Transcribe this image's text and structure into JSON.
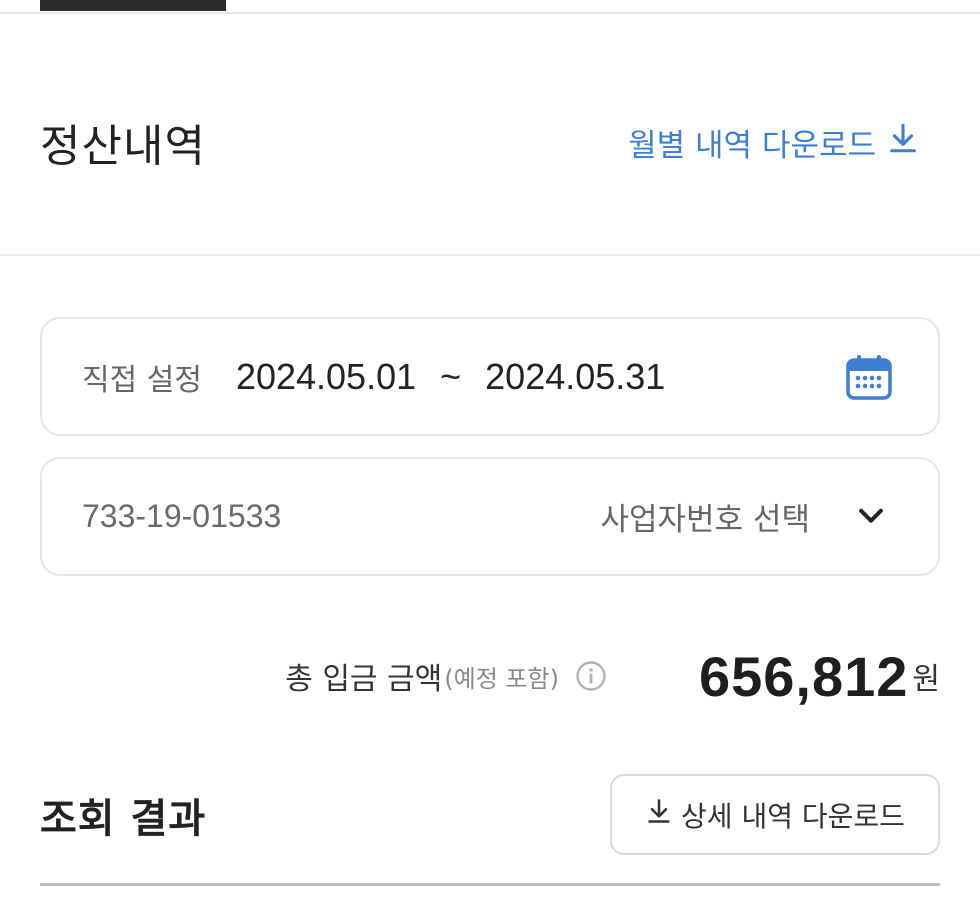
{
  "header": {
    "title": "정산내역",
    "monthly_download_label": "월별 내역 다운로드",
    "download_icon": "download-icon"
  },
  "date_filter": {
    "mode_label": "직접 설정",
    "start_date": "2024.05.01",
    "separator": "~",
    "end_date": "2024.05.31",
    "calendar_icon": "calendar-icon"
  },
  "business_filter": {
    "business_number": "733-19-01533",
    "select_label": "사업자번호 선택",
    "chevron_icon": "chevron-down-icon"
  },
  "total": {
    "label": "총 입금 금액",
    "sublabel": "(예정 포함)",
    "info_icon": "info-icon",
    "amount": "656,812",
    "unit": "원"
  },
  "results": {
    "title": "조회 결과",
    "detail_download_label": "상세 내역 다운로드"
  },
  "colors": {
    "accent": "#3d7fd1",
    "text": "#222222",
    "muted": "#666666",
    "border": "#e6e6e6"
  }
}
